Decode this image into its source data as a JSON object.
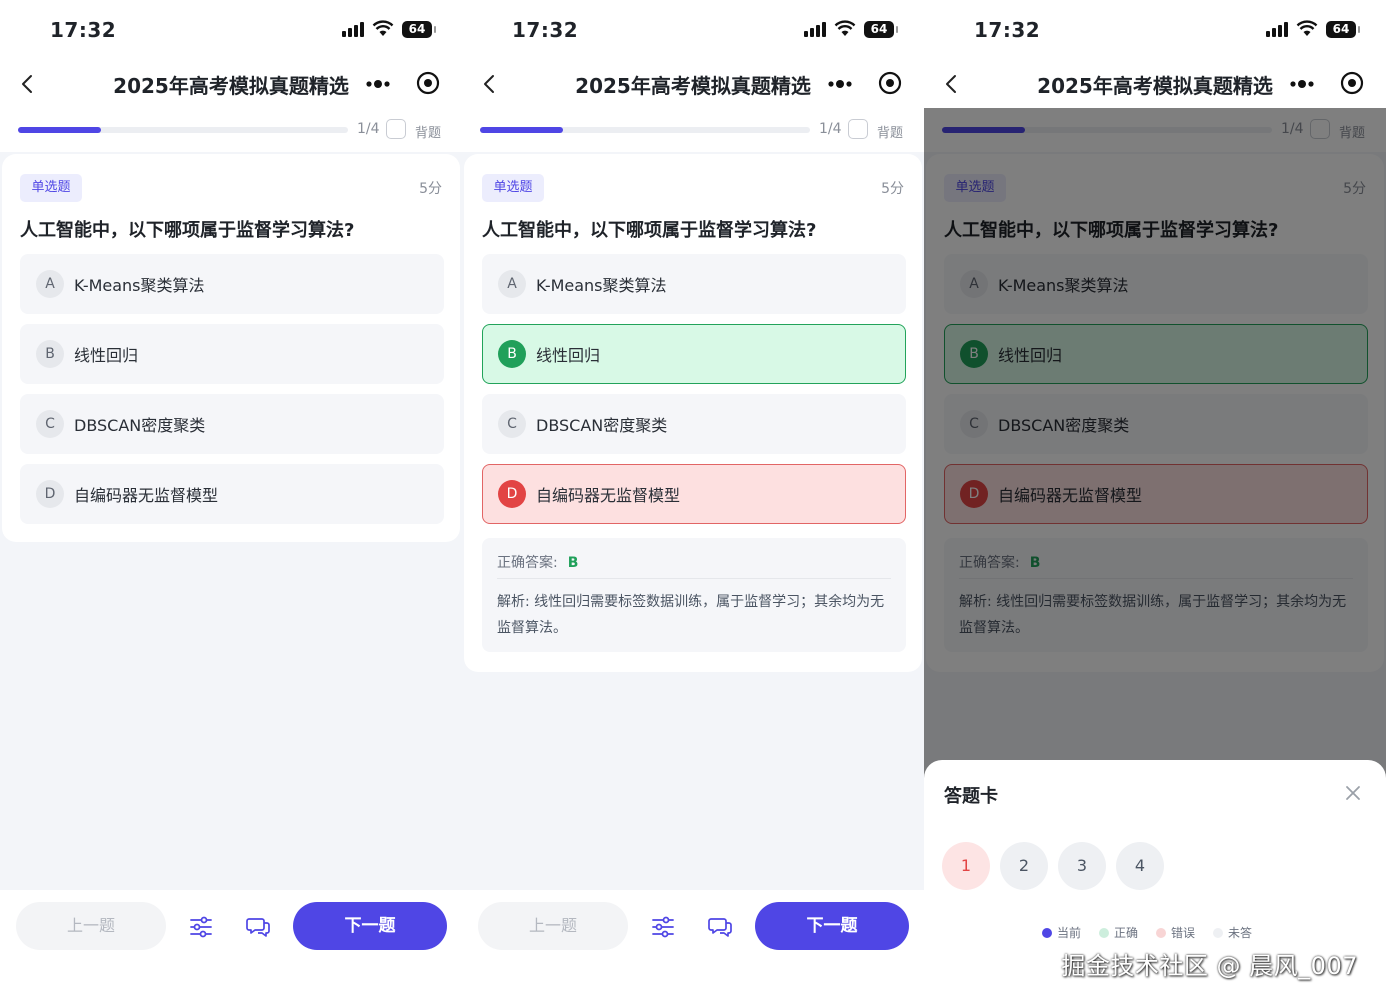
{
  "status": {
    "time": "17:32",
    "battery": "64"
  },
  "nav": {
    "title": "2025年高考模拟真题精选"
  },
  "progress": {
    "count": "1/4",
    "fraction": 0.25,
    "memorize_label": "背题"
  },
  "question": {
    "type": "单选题",
    "score": "5分",
    "text": "人工智能中，以下哪项属于监督学习算法?",
    "options": [
      {
        "letter": "A",
        "text": "K-Means聚类算法"
      },
      {
        "letter": "B",
        "text": "线性回归"
      },
      {
        "letter": "C",
        "text": "DBSCAN密度聚类"
      },
      {
        "letter": "D",
        "text": "自编码器无监督模型"
      }
    ]
  },
  "answer": {
    "label": "正确答案:",
    "letter": "B",
    "explanation": "解析: 线性回归需要标签数据训练，属于监督学习；其余均为无监督算法。"
  },
  "bottom": {
    "prev": "上一题",
    "next": "下一题"
  },
  "sheet": {
    "title": "答题卡",
    "numbers": [
      "1",
      "2",
      "3",
      "4"
    ],
    "legend": [
      {
        "label": "当前",
        "color": "#4f46e5"
      },
      {
        "label": "正确",
        "color": "#cdeedd"
      },
      {
        "label": "错误",
        "color": "#f8d5d5"
      },
      {
        "label": "未答",
        "color": "#eef0f3"
      }
    ]
  },
  "watermark": "掘金技术社区 @ 晨风_007",
  "colors": {
    "accent": "#4f46e5",
    "correct": "#20a05a",
    "wrong": "#e24444"
  }
}
